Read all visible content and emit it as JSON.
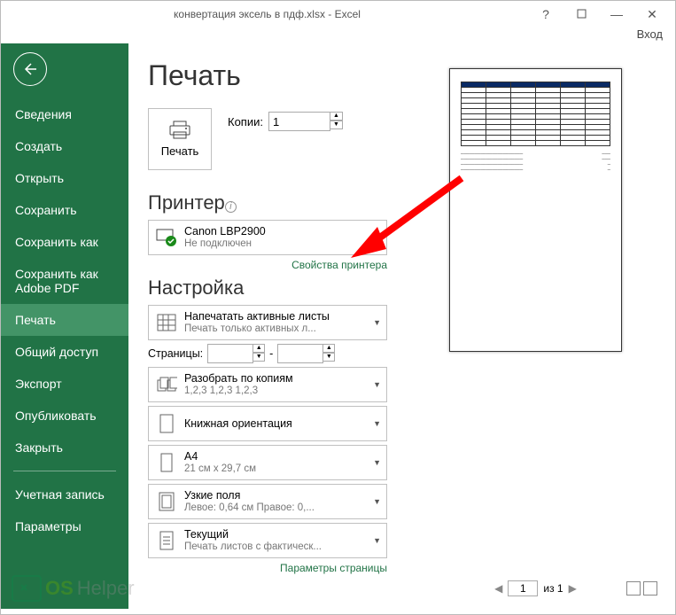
{
  "titlebar": {
    "title": "конвертация эксель в пдф.xlsx - Excel",
    "help": "?"
  },
  "login": "Вход",
  "sidebar": {
    "items": [
      {
        "label": "Сведения"
      },
      {
        "label": "Создать"
      },
      {
        "label": "Открыть"
      },
      {
        "label": "Сохранить"
      },
      {
        "label": "Сохранить как"
      },
      {
        "label": "Сохранить как Adobe PDF"
      },
      {
        "label": "Печать"
      },
      {
        "label": "Общий доступ"
      },
      {
        "label": "Экспорт"
      },
      {
        "label": "Опубликовать"
      },
      {
        "label": "Закрыть"
      }
    ],
    "bottom": [
      {
        "label": "Учетная запись"
      },
      {
        "label": "Параметры"
      }
    ]
  },
  "page": {
    "title": "Печать",
    "printbtn": "Печать",
    "copies_label": "Копии:",
    "copies_value": "1",
    "printer_heading": "Принтер",
    "printer": {
      "name": "Canon LBP2900",
      "status": "Не подключен"
    },
    "printer_props": "Свойства принтера",
    "settings_heading": "Настройка",
    "sheets": {
      "title": "Напечатать активные листы",
      "sub": "Печать только активных л..."
    },
    "pages_label": "Страницы:",
    "pages_sep": "-",
    "collate": {
      "title": "Разобрать по копиям",
      "sub": "1,2,3   1,2,3   1,2,3"
    },
    "orient": {
      "title": "Книжная ориентация"
    },
    "paper": {
      "title": "A4",
      "sub": "21 см x 29,7 см"
    },
    "margins": {
      "title": "Узкие поля",
      "sub": "Левое:  0,64 см   Правое:  0,..."
    },
    "scale": {
      "title": "Текущий",
      "sub": "Печать листов с фактическ..."
    },
    "page_setup": "Параметры страницы",
    "pager": {
      "cur": "1",
      "of": "из 1"
    }
  }
}
